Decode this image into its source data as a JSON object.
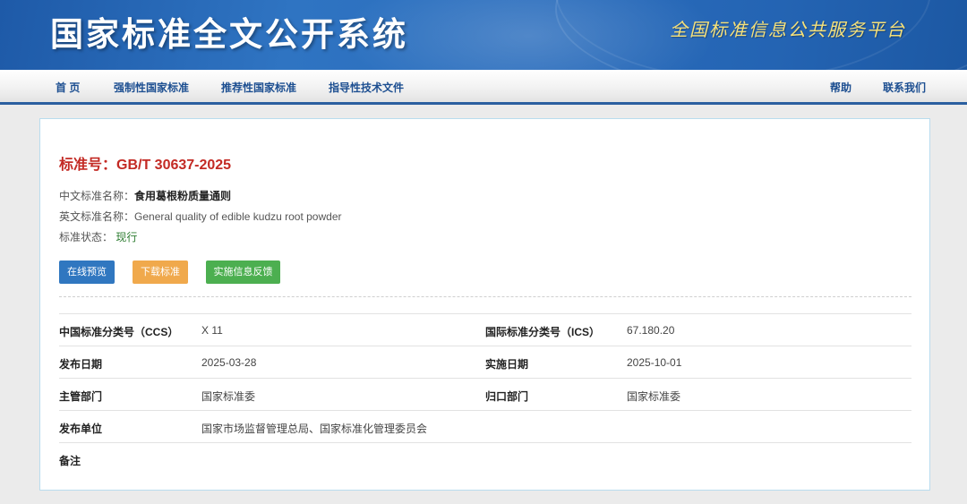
{
  "header": {
    "site_title": "国家标准全文公开系统",
    "slogan": "全国标准信息公共服务平台"
  },
  "nav": {
    "home": "首 页",
    "mandatory": "强制性国家标准",
    "recommended": "推荐性国家标准",
    "guiding": "指导性技术文件",
    "help": "帮助",
    "contact": "联系我们"
  },
  "standard": {
    "number_label": "标准号：GB/T 30637-2025",
    "cn_name_label": "中文标准名称：",
    "cn_name": "食用葛根粉质量通则",
    "en_name_label": "英文标准名称：",
    "en_name": "General quality of edible kudzu root powder",
    "status_label": "标准状态：",
    "status": "现行"
  },
  "buttons": {
    "preview": "在线预览",
    "download": "下载标准",
    "feedback": "实施信息反馈"
  },
  "details": {
    "ccs_label": "中国标准分类号（CCS）",
    "ccs": "X 11",
    "ics_label": "国际标准分类号（ICS）",
    "ics": "67.180.20",
    "publish_label": "发布日期",
    "publish": "2025-03-28",
    "implement_label": "实施日期",
    "implement": "2025-10-01",
    "dept_label": "主管部门",
    "dept": "国家标准委",
    "owner_label": "归口部门",
    "owner": "国家标准委",
    "issuer_label": "发布单位",
    "issuer": "国家市场监督管理总局、国家标准化管理委员会",
    "remark_label": "备注",
    "remark": ""
  },
  "colors": {
    "banner_blue": "#2a6dbd",
    "nav_text": "#1d4f91",
    "std_number_red": "#c32a24",
    "status_green": "#2e7d32",
    "btn_blue": "#3077c0",
    "btn_orange": "#f0a94c",
    "btn_green": "#4caf50"
  }
}
